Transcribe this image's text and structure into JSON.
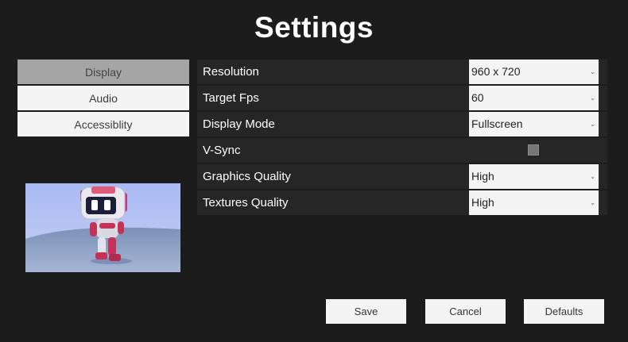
{
  "page": {
    "title": "Settings"
  },
  "tabs": [
    {
      "label": "Display",
      "selected": true
    },
    {
      "label": "Audio",
      "selected": false
    },
    {
      "label": "Accessiblity",
      "selected": false
    }
  ],
  "settings": {
    "resolution": {
      "label": "Resolution",
      "value": "960 x 720"
    },
    "target_fps": {
      "label": "Target Fps",
      "value": "60"
    },
    "display_mode": {
      "label": "Display Mode",
      "value": "Fullscreen"
    },
    "vsync": {
      "label": "V-Sync",
      "checked": false
    },
    "graphics_quality": {
      "label": "Graphics Quality",
      "value": "High"
    },
    "textures_quality": {
      "label": "Textures Quality",
      "value": "High"
    }
  },
  "buttons": {
    "save": "Save",
    "cancel": "Cancel",
    "defaults": "Defaults"
  },
  "icons": {
    "dropdown_arrow": "chevron-down-icon",
    "arrow_glyph": "⌄"
  },
  "colors": {
    "background": "#1c1c1c",
    "row_background": "#262626",
    "selected_tab": "#a5a5a5",
    "control": "#f4f4f4"
  }
}
